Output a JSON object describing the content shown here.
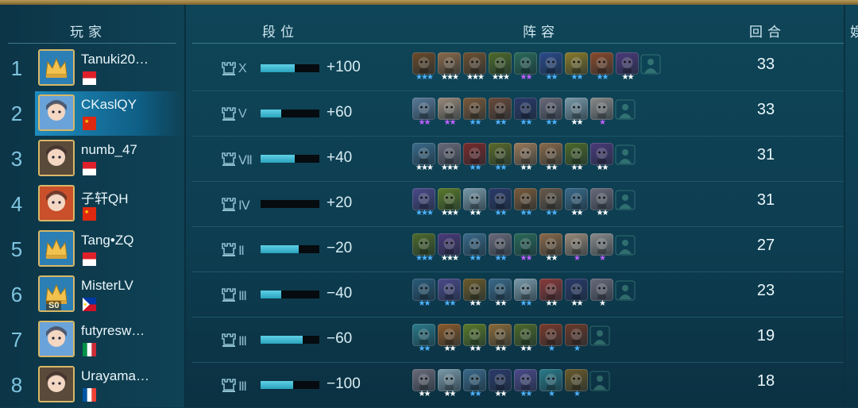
{
  "headers": {
    "player": "玩家",
    "tier": "段位",
    "lineup": "阵容",
    "rounds": "回合",
    "extra": "娱"
  },
  "rows": [
    {
      "rank": "1",
      "name": "Tanuki20…",
      "flag": "red-white",
      "tier": "X",
      "bar": 0.58,
      "delta": "+100",
      "rounds": "33",
      "units": [
        [
          "#6b4a2a",
          "★★★",
          "#4fb3ff"
        ],
        [
          "#8a6a4a",
          "★★★",
          "#ffffff"
        ],
        [
          "#6e5030",
          "★★★",
          "#ffffff"
        ],
        [
          "#4d6a2a",
          "★★★",
          "#ffffff"
        ],
        [
          "#2a6a5a",
          "★★",
          "#c060ff"
        ],
        [
          "#2a4a8a",
          "★★",
          "#4fb3ff"
        ],
        [
          "#8a7a2a",
          "★★",
          "#4fb3ff"
        ],
        [
          "#8a4a2a",
          "★★",
          "#4fb3ff"
        ],
        [
          "#4a3a7a",
          "★★",
          "#ffffff"
        ]
      ]
    },
    {
      "rank": "2",
      "name": "CKaslQY",
      "flag": "china",
      "tier": "V",
      "bar": 0.35,
      "delta": "+60",
      "rounds": "33",
      "highlight": true,
      "units": [
        [
          "#5a7a9a",
          "★★",
          "#c060ff"
        ],
        [
          "#9a8a7a",
          "★★",
          "#c060ff"
        ],
        [
          "#7a5a3a",
          "★★",
          "#4fb3ff"
        ],
        [
          "#6a4a3a",
          "★★",
          "#4fb3ff"
        ],
        [
          "#2a3a6a",
          "★★",
          "#4fb3ff"
        ],
        [
          "#6a6a7a",
          "★★",
          "#4fb3ff"
        ],
        [
          "#7a9aaa",
          "★★",
          "#ffffff"
        ],
        [
          "#8a8a8a",
          "★",
          "#c060ff"
        ]
      ]
    },
    {
      "rank": "3",
      "name": "numb_47",
      "flag": "red-white",
      "tier": "Ⅶ",
      "bar": 0.58,
      "delta": "+40",
      "rounds": "31",
      "units": [
        [
          "#3a6a8a",
          "★★★",
          "#ffffff"
        ],
        [
          "#6a6a7a",
          "★★★",
          "#ffffff"
        ],
        [
          "#7a2a2a",
          "★★",
          "#4fb3ff"
        ],
        [
          "#5a6a2a",
          "★★",
          "#4fb3ff"
        ],
        [
          "#9a7a5a",
          "★★",
          "#ffffff"
        ],
        [
          "#8a6a4a",
          "★★",
          "#ffffff"
        ],
        [
          "#4d6a2a",
          "★★",
          "#ffffff"
        ],
        [
          "#4a3a7a",
          "★★",
          "#ffffff"
        ]
      ]
    },
    {
      "rank": "4",
      "name": "子轩QH",
      "flag": "china",
      "tier": "Ⅳ",
      "bar": 0.0,
      "delta": "+20",
      "rounds": "31",
      "units": [
        [
          "#4a4a8a",
          "★★★",
          "#4fb3ff"
        ],
        [
          "#5a7a2a",
          "★★★",
          "#ffffff"
        ],
        [
          "#7a9aaa",
          "★★",
          "#ffffff"
        ],
        [
          "#2a3a6a",
          "★★",
          "#4fb3ff"
        ],
        [
          "#7a5a3a",
          "★★",
          "#4fb3ff"
        ],
        [
          "#6a5a4a",
          "★★",
          "#4fb3ff"
        ],
        [
          "#3a6a8a",
          "★★",
          "#ffffff"
        ],
        [
          "#6a6a7a",
          "★★",
          "#ffffff"
        ]
      ]
    },
    {
      "rank": "5",
      "name": "Tang•ZQ",
      "flag": "red-white",
      "tier": "Ⅱ",
      "bar": 0.65,
      "delta": "−20",
      "rounds": "27",
      "units": [
        [
          "#4d6a2a",
          "★★★",
          "#4fb3ff"
        ],
        [
          "#4a3a7a",
          "★★★",
          "#ffffff"
        ],
        [
          "#3a6a8a",
          "★★",
          "#4fb3ff"
        ],
        [
          "#6a6a7a",
          "★★",
          "#4fb3ff"
        ],
        [
          "#2a6a5a",
          "★★",
          "#c060ff"
        ],
        [
          "#8a6a4a",
          "★★",
          "#ffffff"
        ],
        [
          "#9a8a7a",
          "★",
          "#c060ff"
        ],
        [
          "#8a8a8a",
          "★",
          "#c060ff"
        ]
      ]
    },
    {
      "rank": "6",
      "name": "MisterLV",
      "flag": "philippines",
      "tier": "Ⅲ",
      "bar": 0.35,
      "delta": "−40",
      "rounds": "23",
      "badge": "S0",
      "units": [
        [
          "#2a5a7a",
          "★★",
          "#4fb3ff"
        ],
        [
          "#4a4a8a",
          "★★",
          "#4fb3ff"
        ],
        [
          "#6a5a2a",
          "★★",
          "#ffffff"
        ],
        [
          "#3a6a8a",
          "★★",
          "#ffffff"
        ],
        [
          "#7a9aaa",
          "★★",
          "#4fb3ff"
        ],
        [
          "#8a3a3a",
          "★★",
          "#ffffff"
        ],
        [
          "#2a3a6a",
          "★★",
          "#ffffff"
        ],
        [
          "#6a6a7a",
          "★",
          "#ffffff"
        ]
      ]
    },
    {
      "rank": "7",
      "name": "futyresw…",
      "flag": "italy",
      "tier": "Ⅲ",
      "bar": 0.72,
      "delta": "−60",
      "rounds": "19",
      "units": [
        [
          "#2a7a8a",
          "★★",
          "#4fb3ff"
        ],
        [
          "#8a5a2a",
          "★★",
          "#ffffff"
        ],
        [
          "#5a7a2a",
          "★★",
          "#ffffff"
        ],
        [
          "#8a6a3a",
          "★★",
          "#ffffff"
        ],
        [
          "#4d6a2a",
          "★★",
          "#ffffff"
        ],
        [
          "#7a3a2a",
          "★",
          "#4fb3ff"
        ],
        [
          "#6a3a2a",
          "★",
          "#4fb3ff"
        ]
      ]
    },
    {
      "rank": "8",
      "name": "Urayama…",
      "flag": "france",
      "tier": "Ⅲ",
      "bar": 0.55,
      "delta": "−100",
      "rounds": "18",
      "units": [
        [
          "#6a6a7a",
          "★★",
          "#ffffff"
        ],
        [
          "#7a9aaa",
          "★★",
          "#ffffff"
        ],
        [
          "#3a6a8a",
          "★★",
          "#4fb3ff"
        ],
        [
          "#2a3a6a",
          "★★",
          "#ffffff"
        ],
        [
          "#4a4a8a",
          "★★",
          "#4fb3ff"
        ],
        [
          "#2a7a8a",
          "★",
          "#4fb3ff"
        ],
        [
          "#6a5a2a",
          "★",
          "#4fb3ff"
        ]
      ]
    }
  ],
  "colors": {
    "bar_fill": "#3bb8d0",
    "highlight": "#1f8cbf",
    "frame": "#d8b766"
  }
}
